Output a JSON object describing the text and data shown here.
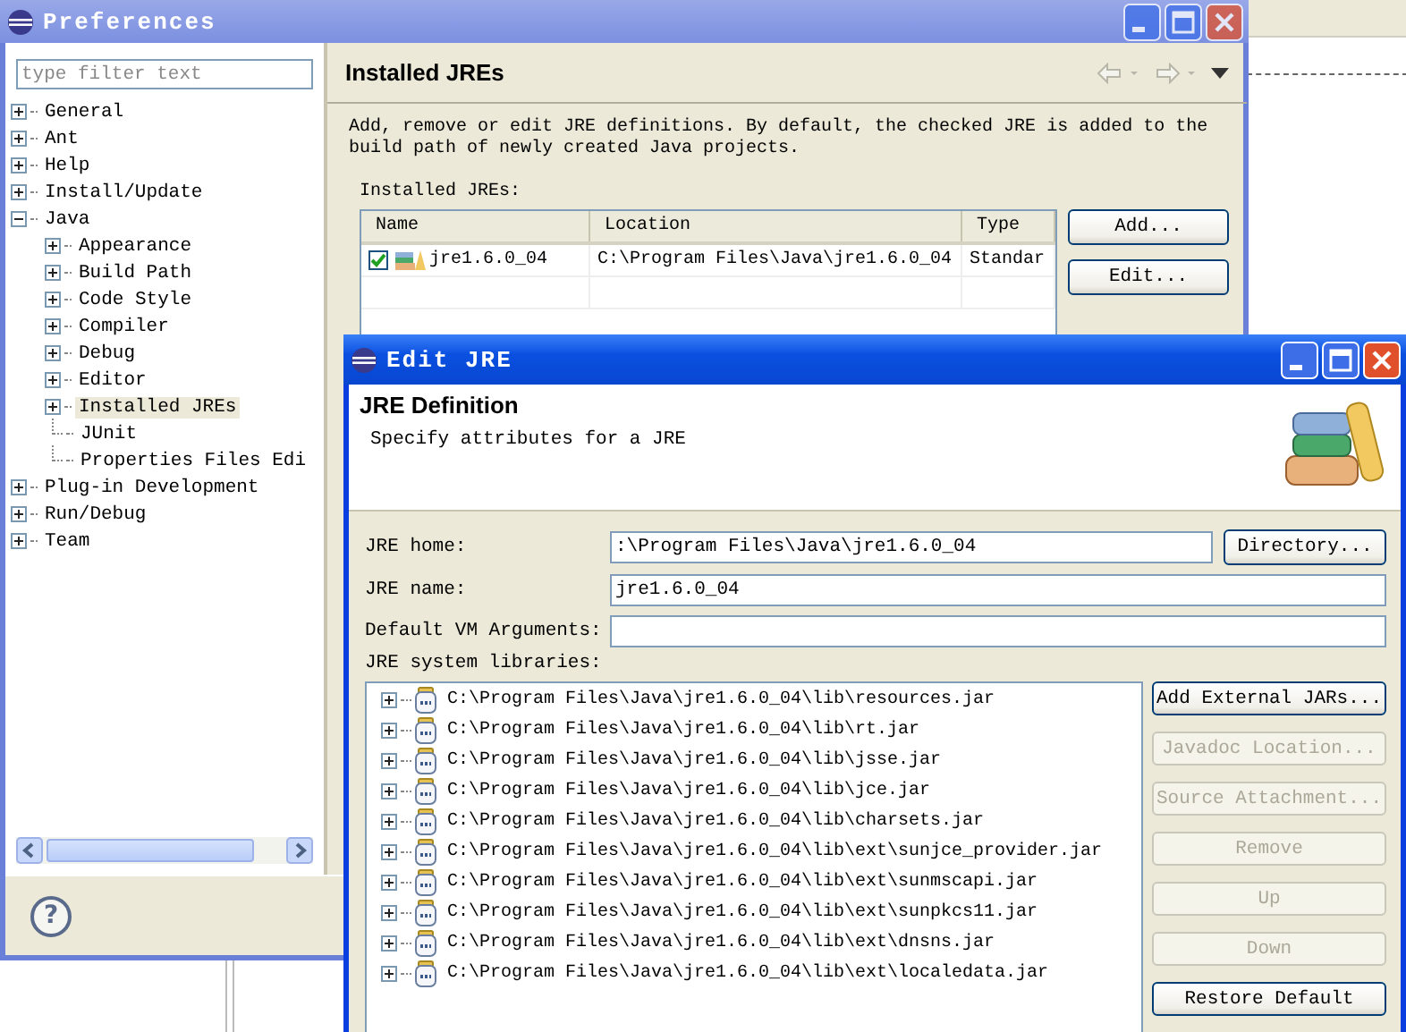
{
  "preferences": {
    "title": "Preferences",
    "filter": {
      "placeholder": "type filter text"
    },
    "tree": [
      {
        "label": "General",
        "kind": "folder",
        "expanded": false,
        "selected": false
      },
      {
        "label": "Ant",
        "kind": "folder",
        "expanded": false,
        "selected": false
      },
      {
        "label": "Help",
        "kind": "folder",
        "expanded": false,
        "selected": false
      },
      {
        "label": "Install/Update",
        "kind": "folder",
        "expanded": false,
        "selected": false
      },
      {
        "label": "Java",
        "kind": "folder",
        "expanded": true,
        "selected": false,
        "children": [
          {
            "label": "Appearance",
            "kind": "folder",
            "expanded": false,
            "selected": false
          },
          {
            "label": "Build Path",
            "kind": "folder",
            "expanded": false,
            "selected": false
          },
          {
            "label": "Code Style",
            "kind": "folder",
            "expanded": false,
            "selected": false
          },
          {
            "label": "Compiler",
            "kind": "folder",
            "expanded": false,
            "selected": false
          },
          {
            "label": "Debug",
            "kind": "folder",
            "expanded": false,
            "selected": false
          },
          {
            "label": "Editor",
            "kind": "folder",
            "expanded": false,
            "selected": false
          },
          {
            "label": "Installed JREs",
            "kind": "folder",
            "expanded": false,
            "selected": true
          },
          {
            "label": "JUnit",
            "kind": "leaf",
            "selected": false
          },
          {
            "label": "Properties Files Edi",
            "kind": "leaf",
            "selected": false
          }
        ]
      },
      {
        "label": "Plug-in Development",
        "kind": "folder",
        "expanded": false,
        "selected": false
      },
      {
        "label": "Run/Debug",
        "kind": "folder",
        "expanded": false,
        "selected": false
      },
      {
        "label": "Team",
        "kind": "folder",
        "expanded": false,
        "selected": false
      }
    ],
    "help": "?",
    "page": {
      "title": "Installed JREs",
      "description": "Add, remove or edit JRE definitions. By default, the checked JRE is added to the build path of newly created Java projects.",
      "table_label": "Installed JREs:",
      "columns": [
        "Name",
        "Location",
        "Type"
      ],
      "rows": [
        {
          "checked": true,
          "name": "jre1.6.0_04",
          "location": "C:\\Program Files\\Java\\jre1.6.0_04",
          "type": "Standar"
        }
      ],
      "buttons": [
        "Add...",
        "Edit..."
      ]
    }
  },
  "edit_jre": {
    "title": "Edit JRE",
    "heading": "JRE Definition",
    "subtitle": "Specify attributes for a JRE",
    "fields": [
      {
        "label": "JRE home:",
        "value": ":\\Program Files\\Java\\jre1.6.0_04",
        "button": "Directory..."
      },
      {
        "label": "JRE name:",
        "value": "jre1.6.0_04"
      },
      {
        "label": "Default VM Arguments:"
      }
    ],
    "libraries_label": "JRE system libraries:",
    "libraries": [
      "C:\\Program Files\\Java\\jre1.6.0_04\\lib\\resources.jar",
      "C:\\Program Files\\Java\\jre1.6.0_04\\lib\\rt.jar",
      "C:\\Program Files\\Java\\jre1.6.0_04\\lib\\jsse.jar",
      "C:\\Program Files\\Java\\jre1.6.0_04\\lib\\jce.jar",
      "C:\\Program Files\\Java\\jre1.6.0_04\\lib\\charsets.jar",
      "C:\\Program Files\\Java\\jre1.6.0_04\\lib\\ext\\sunjce_provider.jar",
      "C:\\Program Files\\Java\\jre1.6.0_04\\lib\\ext\\sunmscapi.jar",
      "C:\\Program Files\\Java\\jre1.6.0_04\\lib\\ext\\sunpkcs11.jar",
      "C:\\Program Files\\Java\\jre1.6.0_04\\lib\\ext\\dnsns.jar",
      "C:\\Program Files\\Java\\jre1.6.0_04\\lib\\ext\\localedata.jar"
    ],
    "buttons": [
      {
        "label": "Add External JARs...",
        "disabled": false
      },
      {
        "label": "Javadoc Location...",
        "disabled": true
      },
      {
        "label": "Source Attachment...",
        "disabled": true
      },
      {
        "label": "Remove",
        "disabled": true
      },
      {
        "label": "Up",
        "disabled": true
      },
      {
        "label": "Down",
        "disabled": true
      },
      {
        "label": "Restore Default",
        "disabled": false
      }
    ]
  }
}
